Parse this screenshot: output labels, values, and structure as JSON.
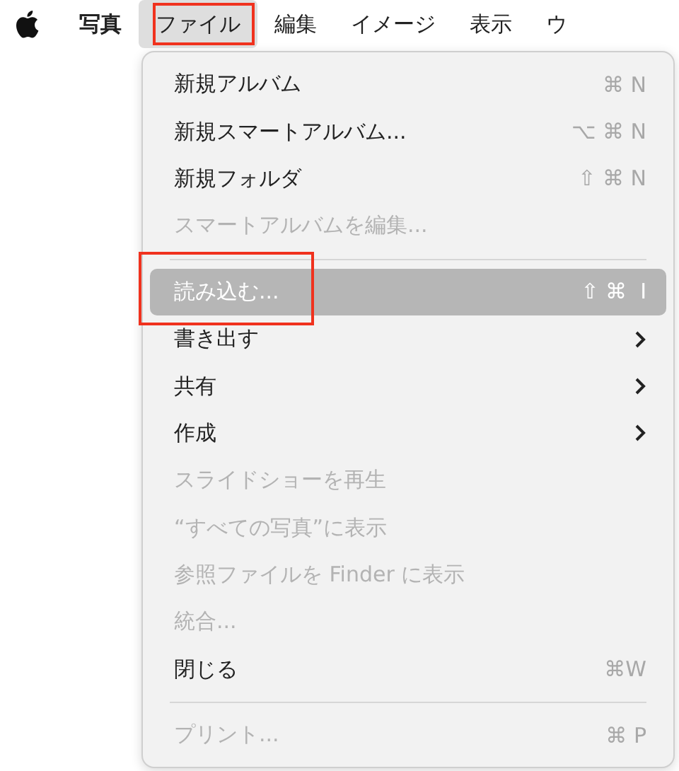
{
  "menubar": {
    "items": [
      {
        "label": "写真",
        "bold": true,
        "selected": false,
        "annotated": false
      },
      {
        "label": "ファイル",
        "bold": false,
        "selected": true,
        "annotated": true
      },
      {
        "label": "編集",
        "bold": false,
        "selected": false,
        "annotated": false
      },
      {
        "label": "イメージ",
        "bold": false,
        "selected": false,
        "annotated": false
      },
      {
        "label": "表示",
        "bold": false,
        "selected": false,
        "annotated": false
      },
      {
        "label": "ウ",
        "bold": false,
        "selected": false,
        "annotated": false
      }
    ]
  },
  "menu": {
    "items": [
      {
        "kind": "item",
        "label": "新規アルバム",
        "shortcut": "⌘ N",
        "disabled": false,
        "selected": false,
        "submenu": false,
        "annotated": false
      },
      {
        "kind": "item",
        "label": "新規スマートアルバム...",
        "shortcut": "⌥ ⌘ N",
        "disabled": false,
        "selected": false,
        "submenu": false,
        "annotated": false
      },
      {
        "kind": "item",
        "label": "新規フォルダ",
        "shortcut": "⇧ ⌘ N",
        "disabled": false,
        "selected": false,
        "submenu": false,
        "annotated": false
      },
      {
        "kind": "item",
        "label": "スマートアルバムを編集...",
        "disabled": true,
        "selected": false,
        "submenu": false,
        "annotated": false
      },
      {
        "kind": "separator"
      },
      {
        "kind": "item",
        "label": "読み込む...",
        "shortcut": "⇧ ⌘  I",
        "disabled": false,
        "selected": true,
        "submenu": false,
        "annotated": true
      },
      {
        "kind": "item",
        "label": "書き出す",
        "disabled": false,
        "selected": false,
        "submenu": true,
        "annotated": false
      },
      {
        "kind": "item",
        "label": "共有",
        "disabled": false,
        "selected": false,
        "submenu": true,
        "annotated": false
      },
      {
        "kind": "item",
        "label": "作成",
        "disabled": false,
        "selected": false,
        "submenu": true,
        "annotated": false
      },
      {
        "kind": "item",
        "label": "スライドショーを再生",
        "disabled": true,
        "selected": false,
        "submenu": false,
        "annotated": false
      },
      {
        "kind": "item",
        "label": "“すべての写真”に表示",
        "disabled": true,
        "selected": false,
        "submenu": false,
        "annotated": false
      },
      {
        "kind": "item",
        "label": "参照ファイルを Finder に表示",
        "disabled": true,
        "selected": false,
        "submenu": false,
        "annotated": false
      },
      {
        "kind": "item",
        "label": "統合...",
        "disabled": true,
        "selected": false,
        "submenu": false,
        "annotated": false
      },
      {
        "kind": "item",
        "label": "閉じる",
        "shortcut": "⌘W",
        "disabled": false,
        "selected": false,
        "submenu": false,
        "annotated": false
      },
      {
        "kind": "separator"
      },
      {
        "kind": "item",
        "label": "プリント...",
        "shortcut": "⌘ P",
        "disabled": true,
        "selected": false,
        "submenu": false,
        "annotated": false
      }
    ]
  }
}
